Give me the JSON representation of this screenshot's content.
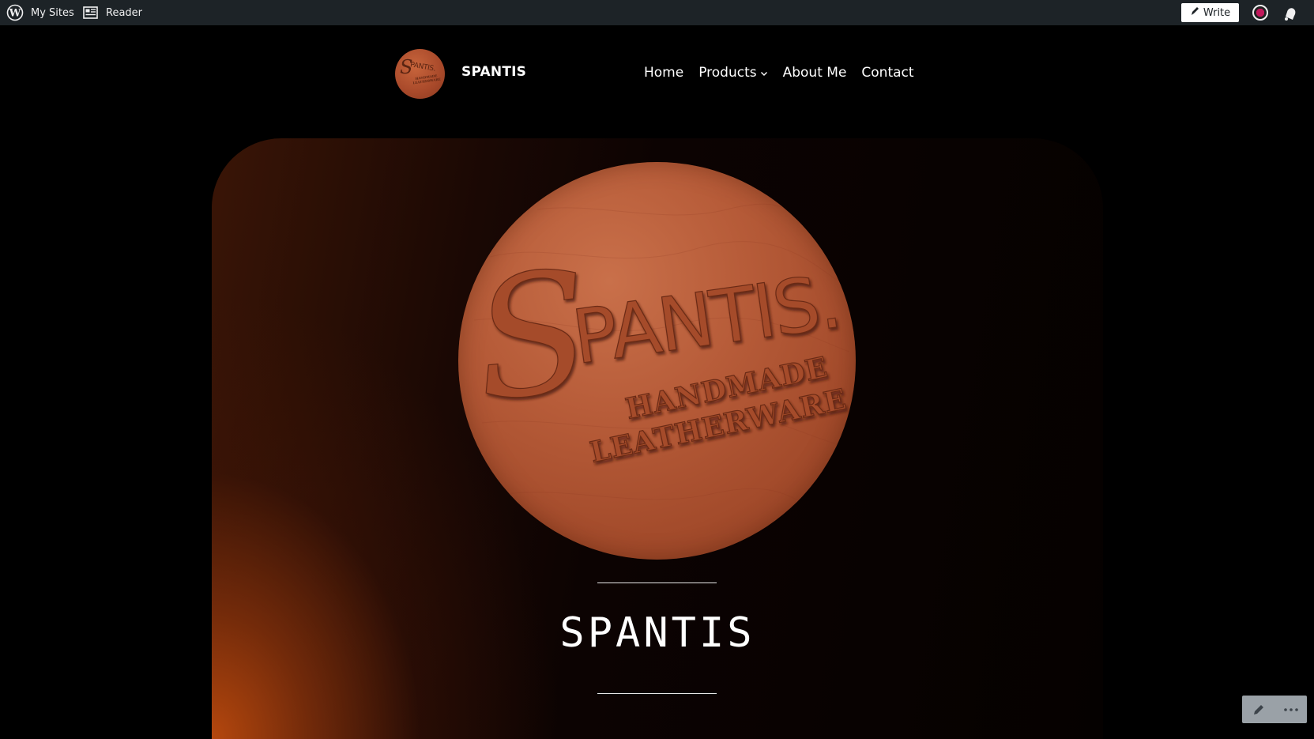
{
  "adminbar": {
    "my_sites": "My Sites",
    "reader": "Reader",
    "write": "Write"
  },
  "header": {
    "site_title": "SPANTIS",
    "logo": {
      "mark": "S",
      "wordmark": "PANTIS.",
      "tagline_1": "HANDMADE",
      "tagline_2": "LEATHERWARE"
    },
    "nav": [
      {
        "label": "Home"
      },
      {
        "label": "Products"
      },
      {
        "label": "About Me"
      },
      {
        "label": "Contact"
      }
    ]
  },
  "hero": {
    "medallion": {
      "mark": "S",
      "wordmark": "PANTIS.",
      "tagline_1": "HANDMADE",
      "tagline_2": "LEATHERWARE"
    },
    "title": "SPANTIS"
  },
  "icons": {
    "wordpress": "wordpress-icon",
    "reader": "reader-icon",
    "write": "pen-icon",
    "avatar": "avatar",
    "notifications": "bell-icon",
    "edit": "pencil-icon",
    "more": "ellipsis-icon"
  },
  "colors": {
    "adminbar_bg": "#1d2327",
    "page_bg": "#000000",
    "leather": "#b65b38",
    "glow": "#bc4a0e"
  }
}
